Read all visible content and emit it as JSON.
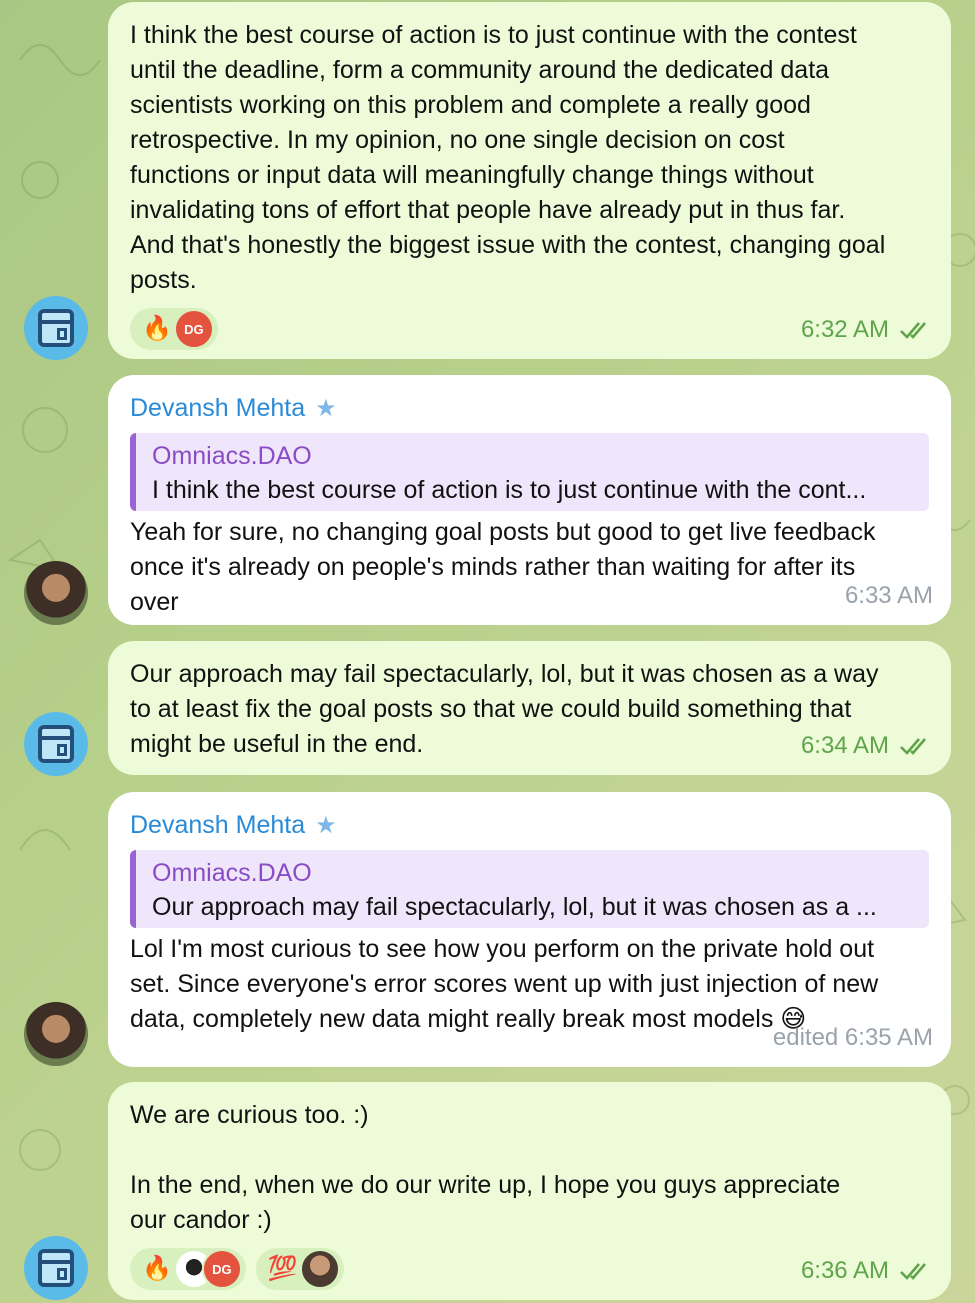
{
  "messages": [
    {
      "text": "I think the best course of action is to just continue with the contest\nuntil the deadline, form a community around the dedicated data\nscientists working on this problem and complete a really good\nretrospective. In my opinion, no one single decision on cost\nfunctions or input data will meaningfully change things without\ninvalidating tons of effort that people have already put in thus far.\nAnd that's honestly the biggest issue with the contest, changing goal\nposts.",
      "reactions": [
        {
          "emoji": "🔥",
          "avatars": [
            "DG"
          ]
        }
      ],
      "time": "6:32 AM"
    },
    {
      "sender": "Devansh Mehta",
      "quote_name": "Omniacs.DAO",
      "quote_text": "I think the best course of action is to just continue with the cont...",
      "text": "Yeah for sure, no changing goal posts but good to get live feedback\nonce it's already on people's minds rather than waiting for after its\nover",
      "time": "6:33 AM"
    },
    {
      "text": "Our approach may fail spectacularly, lol, but it was chosen as a way\nto at least fix the goal posts so that we could build something that\nmight be useful in the end.",
      "time": "6:34 AM"
    },
    {
      "sender": "Devansh Mehta",
      "quote_name": "Omniacs.DAO",
      "quote_text": "Our approach may fail spectacularly, lol, but it was chosen as a ...",
      "text": "Lol I'm most curious to see how you perform on the private hold out\nset. Since everyone's error scores went up with just injection of new\ndata, completely new data might really break most models 😅",
      "time": "edited 6:35 AM"
    },
    {
      "text": "We are curious too. :)\n\nIn the end, when we do our write up, I hope you guys appreciate\nour candor :)",
      "reactions": [
        {
          "emoji": "🔥",
          "avatars": [
            "",
            "DG"
          ]
        },
        {
          "emoji": "💯",
          "avatars": [
            ""
          ]
        }
      ],
      "time": "6:36 AM"
    }
  ],
  "colors": {
    "outgoing_bubble": "#eefbd9",
    "incoming_bubble": "#ffffff",
    "sender_name": "#2a8ad6",
    "quote_name": "#8a4cc6",
    "read_check": "#5ea44a"
  },
  "icons": {
    "star": "star-icon",
    "read_receipt": "double-check-icon",
    "bot_avatar": "bot-avatar"
  }
}
